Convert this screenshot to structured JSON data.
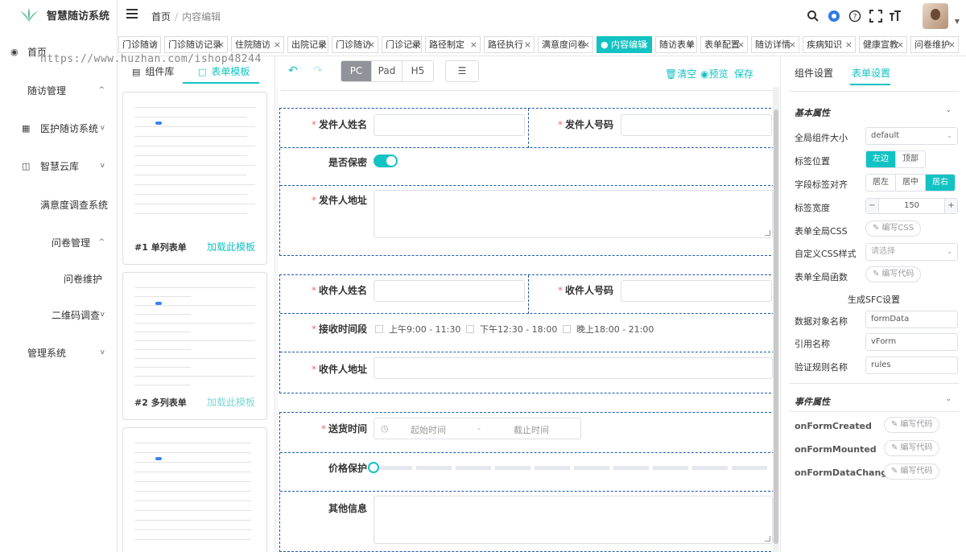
{
  "app": {
    "name": "智慧随访系统",
    "accent": "#13c2c2",
    "watermark": "https://www.huzhan.com/ishop48244"
  },
  "sidebar": {
    "items": [
      {
        "label": "首页",
        "icon": "dashboard-icon"
      },
      {
        "label": "随访管理",
        "arrow": "^"
      },
      {
        "label": "医护随访系统",
        "icon": "grid-icon",
        "arrow": "v"
      },
      {
        "label": "智慧云库",
        "icon": "book-icon",
        "arrow": "v"
      },
      {
        "label": "满意度调查系统",
        "arrow": "^"
      },
      {
        "label": "问卷管理",
        "arrow": "^"
      },
      {
        "label": "问卷维护"
      },
      {
        "label": "二维码调查",
        "arrow": "v"
      },
      {
        "label": "管理系统",
        "arrow": "v"
      }
    ]
  },
  "header": {
    "breadcrumb_home": "首页",
    "breadcrumb_sep": "/",
    "breadcrumb_current": "内容编辑"
  },
  "tags": [
    {
      "label": "门诊随访"
    },
    {
      "label": "门诊随访记录"
    },
    {
      "label": "住院随访"
    },
    {
      "label": "出院记录"
    },
    {
      "label": "门诊随访"
    },
    {
      "label": "门诊记录"
    },
    {
      "label": "路径制定"
    },
    {
      "label": "路径执行"
    },
    {
      "label": "满意度问卷"
    },
    {
      "label": "● 内容编辑",
      "active": true
    },
    {
      "label": "随访表单"
    },
    {
      "label": "表单配置"
    },
    {
      "label": "随访详情"
    },
    {
      "label": "疾病知识"
    },
    {
      "label": "健康宣教"
    },
    {
      "label": "问卷维护"
    }
  ],
  "widget_panel": {
    "tab_components": "组件库",
    "tab_templates": "表单模板",
    "templates": [
      {
        "name": "#1 单列表单",
        "load": "加载此模板"
      },
      {
        "name": "#2 多列表单",
        "load": "加载此模板"
      },
      {
        "name": "",
        "load": ""
      }
    ]
  },
  "toolbar": {
    "devices": [
      "PC",
      "Pad",
      "H5"
    ],
    "active_device": "PC",
    "clear": "清空",
    "preview": "预览",
    "save": "保存"
  },
  "form": {
    "sender_name": "发件人姓名",
    "sender_phone": "发件人号码",
    "confidential": "是否保密",
    "sender_address": "发件人地址",
    "receiver_name": "收件人姓名",
    "receiver_phone": "收件人号码",
    "receive_time": "接收时间段",
    "time_options": [
      "上午9:00 - 11:30",
      "下午12:30 - 18:00",
      "晚上18:00 - 21:00"
    ],
    "receiver_address": "收件人地址",
    "delivery_time": "送货时间",
    "start_placeholder": "起始时间",
    "range_sep": "-",
    "end_placeholder": "截止时间",
    "price_protect": "价格保护",
    "other_info": "其他信息"
  },
  "props": {
    "tab_component": "组件设置",
    "tab_form": "表单设置",
    "basic_section": "基本属性",
    "size_label": "全局组件大小",
    "size_value": "default",
    "label_pos_label": "标签位置",
    "label_pos_options": [
      "左边",
      "顶部"
    ],
    "label_pos_active": "左边",
    "align_label": "字段标签对齐",
    "align_options": [
      "居左",
      "居中",
      "居右"
    ],
    "align_active": "居右",
    "label_width_label": "标签宽度",
    "label_width_value": "150",
    "global_css_label": "表单全局CSS",
    "edit_css": "编写CSS",
    "custom_css_label": "自定义CSS样式",
    "custom_css_placeholder": "请选择",
    "global_func_label": "表单全局函数",
    "edit_code": "编写代码",
    "sfc_title": "生成SFC设置",
    "data_obj_label": "数据对象名称",
    "data_obj_value": "formData",
    "ref_label": "引用名称",
    "ref_value": "vForm",
    "rules_label": "验证规则名称",
    "rules_value": "rules",
    "event_section": "事件属性",
    "events": [
      "onFormCreated",
      "onFormMounted",
      "onFormDataChange"
    ]
  }
}
